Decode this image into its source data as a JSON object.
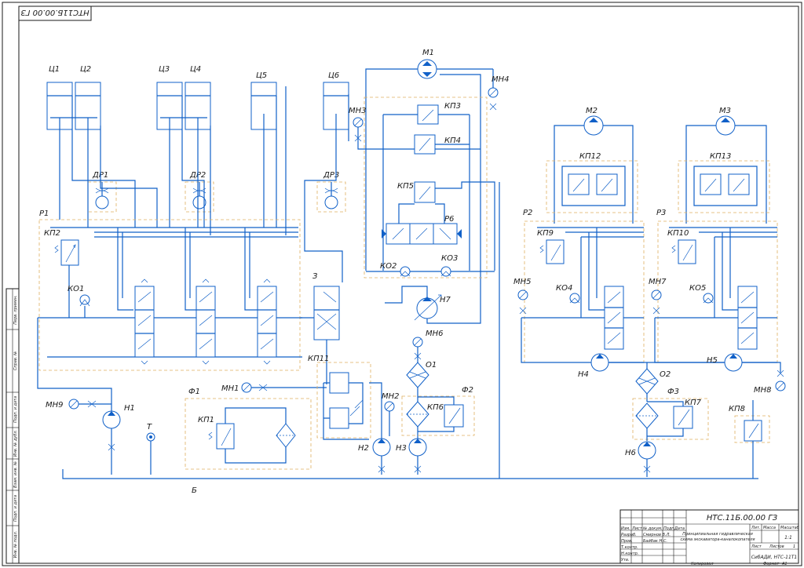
{
  "drawing": {
    "code_mirrored": "НТС11Б.00.00 ГЗ",
    "tank_label": "Б",
    "tank_symbol_label": "Т"
  },
  "labels": {
    "c1": "Ц1",
    "c2": "Ц2",
    "c3": "Ц3",
    "c4": "Ц4",
    "c5": "Ц5",
    "c6": "Ц6",
    "m1": "М1",
    "m2": "М2",
    "m3": "М3",
    "dr1": "ДР1",
    "dr2": "ДР2",
    "dr3": "ДР3",
    "r1": "Р1",
    "r2": "Р2",
    "r3": "Р3",
    "r6": "Р6",
    "kp1": "КП1",
    "kp2": "КП2",
    "kp3": "КП3",
    "kp4": "КП4",
    "kp5": "КП5",
    "kp6": "КП6",
    "kp7": "КП7",
    "kp8": "КП8",
    "kp9": "КП9",
    "kp10": "КП10",
    "kp11": "КП11",
    "kp12": "КП12",
    "kp13": "КП13",
    "ko1": "КО1",
    "ko2": "КО2",
    "ko3": "КО3",
    "ko4": "КО4",
    "ko5": "КО5",
    "mn1": "МН1",
    "mn2": "МН2",
    "mn3": "МН3",
    "mn4": "МН4",
    "mn5": "МН5",
    "mn6": "МН6",
    "mn7": "МН7",
    "mn8": "МН8",
    "mn9": "МН9",
    "h1": "Н1",
    "h2": "Н2",
    "h3": "Н3",
    "h4": "Н4",
    "h5": "Н5",
    "h6": "Н6",
    "h7": "Н7",
    "f1": "Ф1",
    "f2": "Ф2",
    "f3": "Ф3",
    "o1": "О1",
    "o2": "О2",
    "z": "З"
  },
  "side_strip": [
    "Перв. примен.",
    "Справ. №",
    "Подп. и дата",
    "Инв. № дубл.",
    "Взам. инв. №",
    "Подп. и дата",
    "Инв. № подл."
  ],
  "title_block": {
    "code": "НТС.11Б.00.00 ГЗ",
    "title_line1": "Принципиальная гидравлическая",
    "title_line2": "схема экскаватора-каналокопателя",
    "col_izm": "Изм.",
    "col_list": "Лист",
    "col_doc": "№ докум.",
    "col_podp": "Подп.",
    "col_data": "Дата",
    "row_razrab": "Разраб.",
    "name_razrab": "Смирнов В.Л.",
    "row_prov": "Пров.",
    "name_prov": "Байбак Н.С.",
    "row_tkontr": "Т.контр.",
    "row_nkontr": "Н.контр.",
    "row_utv": "Утв.",
    "lit": "Лит.",
    "massa": "Масса",
    "masshtab": "Масштаб",
    "scale_val": "1:1",
    "list_label": "Лист",
    "listov_label": "Листов",
    "listov_val": "1",
    "org": "СибАДИ, НТС-11Т1",
    "kopiroval": "Копировал",
    "format_label": "Формат",
    "format_val": "А1"
  }
}
